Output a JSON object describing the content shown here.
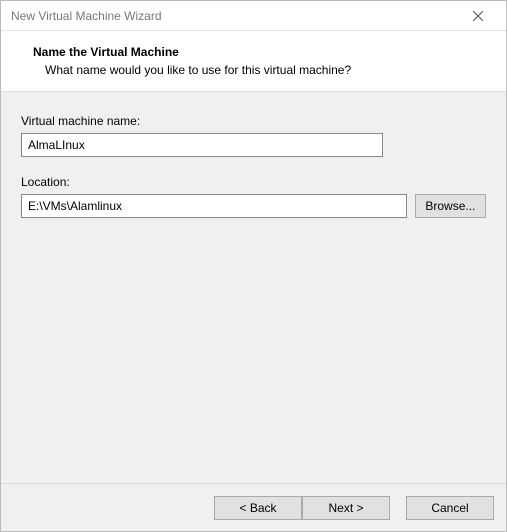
{
  "titlebar": {
    "title": "New Virtual Machine Wizard"
  },
  "header": {
    "title": "Name the Virtual Machine",
    "subtitle": "What name would you like to use for this virtual machine?"
  },
  "form": {
    "vm_name_label": "Virtual machine name:",
    "vm_name_value": "AlmaLInux",
    "location_label": "Location:",
    "location_value": "E:\\VMs\\Alamlinux",
    "browse_label": "Browse..."
  },
  "footer": {
    "back_label": "< Back",
    "next_label": "Next >",
    "cancel_label": "Cancel"
  }
}
